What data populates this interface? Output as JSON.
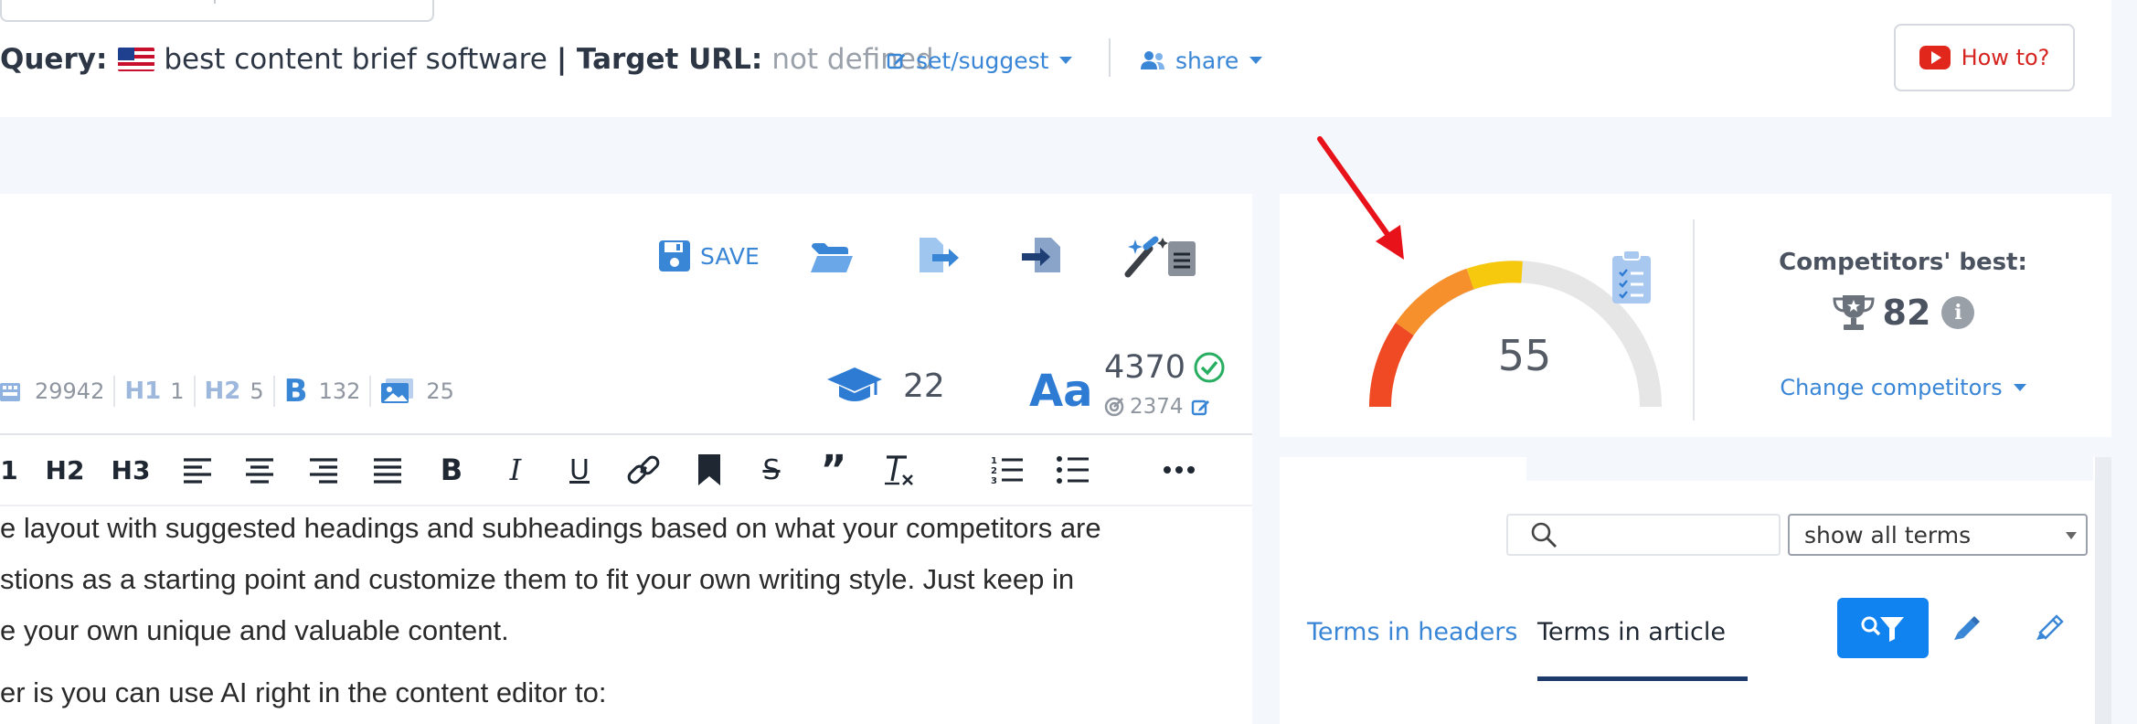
{
  "header": {
    "query_label": "Query:",
    "query_value": "best content brief software",
    "target_label": "| Target URL:",
    "target_value": "not defined",
    "set_suggest": "set/suggest",
    "share": "share",
    "how_to": "How to?"
  },
  "editor": {
    "save_label": "SAVE",
    "stats": {
      "characters": "29942",
      "h1": "1",
      "h2": "5",
      "bold": "132",
      "images": "25"
    },
    "grade_level": "22",
    "font_icon_text": "Aa",
    "word_count": "4370",
    "word_target": "2374",
    "format_toolbar": {
      "heading1_partial": "1",
      "h2": "H2",
      "h3": "H3"
    },
    "content_lines": [
      "e layout with suggested headings and subheadings based on what your competitors are",
      "stions as a starting point and customize them to fit your own writing style. Just keep in",
      "e your own unique and valuable content.",
      "er is you can use AI right in the content editor to:"
    ]
  },
  "score": {
    "value": "55",
    "value_fraction": 0.55,
    "competitors_label": "Competitors' best:",
    "competitors_value": "82",
    "change_competitors": "Change competitors"
  },
  "terms": {
    "search_placeholder": "",
    "filter_option": "show all terms",
    "tab_headers": "Terms in headers",
    "tab_article": "Terms in article"
  },
  "colors": {
    "accent": "#3a86d6",
    "primary_button": "#1183f0",
    "gauge_red": "#f04a24",
    "gauge_orange": "#f5902c",
    "gauge_yellow": "#f7c90e",
    "gauge_empty": "#e6e6e6",
    "annotation_arrow": "#e8131a"
  }
}
